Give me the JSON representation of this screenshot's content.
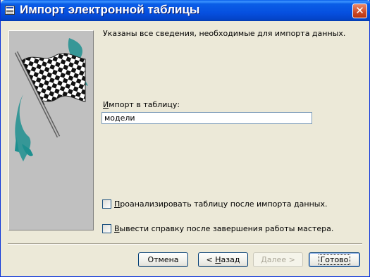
{
  "window": {
    "title": "Импорт электронной таблицы",
    "close_glyph": "✕"
  },
  "side_image": {
    "icon": "checkered-flag-icon",
    "colors": {
      "panel": "#c0c0c0",
      "teal": "#1d8f8f"
    }
  },
  "main": {
    "info_text": "Указаны все сведения, необходимые для импорта данных.",
    "import_label_hotkey": "И",
    "import_label_rest": "мпорт в таблицу:",
    "table_name_value": "модели"
  },
  "options": {
    "analyze_hotkey": "П",
    "analyze_rest": "роанализировать таблицу после импорта данных.",
    "analyze_checked": false,
    "help_hotkey": "В",
    "help_rest": "ывести справку после завершения работы мастера.",
    "help_checked": false
  },
  "buttons": {
    "cancel": "Отмена",
    "back_prefix": "< ",
    "back_hotkey": "Н",
    "back_rest": "азад",
    "next": "Далее >",
    "finish": "Готово"
  }
}
